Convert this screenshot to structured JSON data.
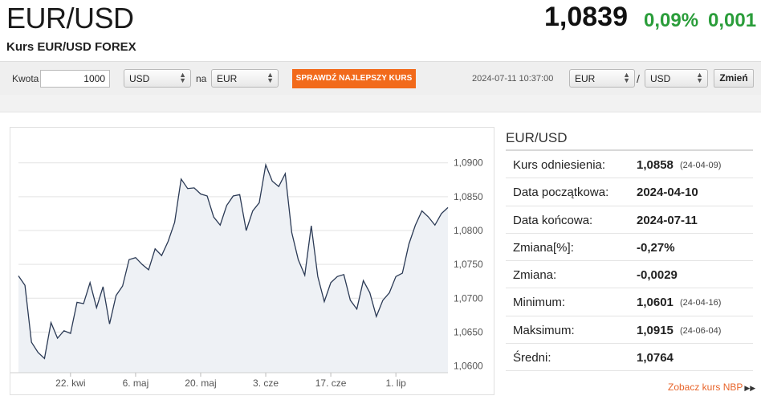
{
  "header": {
    "title": "EUR/USD",
    "subtitle": "Kurs EUR/USD FOREX",
    "price": "1,0839",
    "change_pct": "0,09%",
    "change_abs": "0,001",
    "change_color": "#2a9d3a"
  },
  "toolbar": {
    "amount_label": "Kwota",
    "amount_value": "1000",
    "from_currency": "USD",
    "to_label": "na",
    "to_currency": "EUR",
    "best_rate_button": "SPRAWDŹ NAJLEPSZY KURS",
    "best_rate_color": "#f26a1b",
    "timestamp": "2024-07-11 10:37:00",
    "pair_base": "EUR",
    "slash": "/",
    "pair_quote": "USD",
    "change_button": "Zmień"
  },
  "stats": {
    "title": "EUR/USD",
    "rows": [
      {
        "label": "Kurs odniesienia:",
        "value": "1,0858",
        "date": "(24-04-09)"
      },
      {
        "label": "Data początkowa:",
        "value": "2024-04-10",
        "date": ""
      },
      {
        "label": "Data końcowa:",
        "value": "2024-07-11",
        "date": ""
      },
      {
        "label": "Zmiana[%]:",
        "value": "-0,27%",
        "date": ""
      },
      {
        "label": "Zmiana:",
        "value": "-0,0029",
        "date": ""
      },
      {
        "label": "Minimum:",
        "value": "1,0601",
        "date": "(24-04-16)"
      },
      {
        "label": "Maksimum:",
        "value": "1,0915",
        "date": "(24-06-04)"
      },
      {
        "label": "Średni:",
        "value": "1,0764",
        "date": ""
      }
    ],
    "nbp_link": "Zobacz kurs NBP",
    "nbp_icon": "double-triangle-right-icon"
  },
  "chart_data": {
    "type": "area",
    "ylim": [
      1.059,
      1.094
    ],
    "y_ticks": [
      "1,0600",
      "1,0650",
      "1,0700",
      "1,0750",
      "1,0800",
      "1,0850",
      "1,0900"
    ],
    "y_tick_values": [
      1.06,
      1.065,
      1.07,
      1.075,
      1.08,
      1.085,
      1.09
    ],
    "x_tick_labels": [
      "22. kwi",
      "6. maj",
      "20. maj",
      "3. cze",
      "17. cze",
      "1. lip"
    ],
    "x_tick_index": [
      8,
      18,
      28,
      38,
      48,
      58
    ],
    "line_color": "#2b3a55",
    "fill_color": "#eef1f5",
    "series": [
      {
        "values": [
          1.0733,
          1.0719,
          1.0635,
          1.062,
          1.0611,
          1.0664,
          1.0641,
          1.0652,
          1.0648,
          1.0694,
          1.0692,
          1.0723,
          1.0686,
          1.0717,
          1.0662,
          1.0704,
          1.0718,
          1.0757,
          1.076,
          1.075,
          1.0742,
          1.0773,
          1.0763,
          1.0784,
          1.0812,
          1.0876,
          1.0862,
          1.0863,
          1.0854,
          1.0851,
          1.082,
          1.0808,
          1.0837,
          1.0851,
          1.0853,
          1.08,
          1.0829,
          1.0841,
          1.0897,
          1.0873,
          1.0865,
          1.0884,
          1.0797,
          1.0757,
          1.0734,
          1.0807,
          1.0732,
          1.0695,
          1.0723,
          1.0732,
          1.0735,
          1.0697,
          1.0684,
          1.0726,
          1.0708,
          1.0673,
          1.0697,
          1.0708,
          1.0732,
          1.0737,
          1.078,
          1.0808,
          1.0829,
          1.082,
          1.0808,
          1.0825,
          1.0834
        ]
      }
    ]
  }
}
